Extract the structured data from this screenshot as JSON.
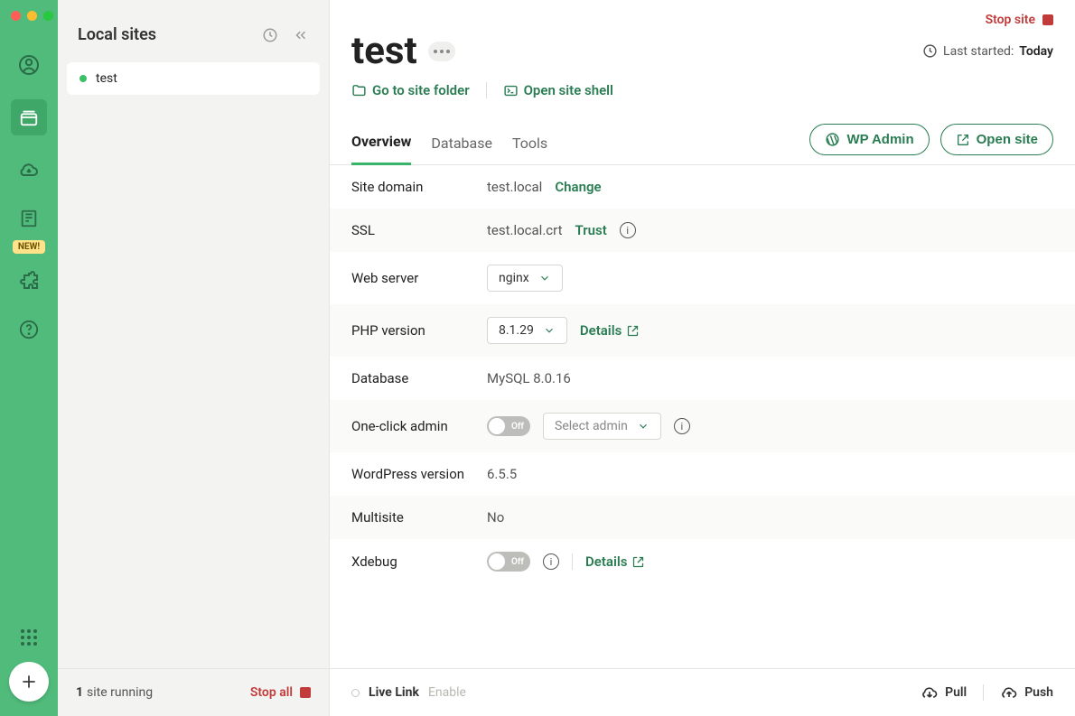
{
  "sidebar": {
    "title": "Local sites",
    "new_badge": "NEW!",
    "sites": [
      {
        "name": "test",
        "running": true
      }
    ],
    "footer": {
      "count": "1",
      "label": "site running",
      "stop_all": "Stop all"
    }
  },
  "topbar": {
    "stop_site": "Stop site"
  },
  "header": {
    "site_name": "test",
    "last_started_label": "Last started:",
    "last_started_value": "Today",
    "go_to_folder": "Go to site folder",
    "open_shell": "Open site shell"
  },
  "tabs": {
    "overview": "Overview",
    "database": "Database",
    "tools": "Tools",
    "wp_admin": "WP Admin",
    "open_site": "Open site"
  },
  "details": {
    "site_domain": {
      "label": "Site domain",
      "value": "test.local",
      "action": "Change"
    },
    "ssl": {
      "label": "SSL",
      "value": "test.local.crt",
      "action": "Trust"
    },
    "web_server": {
      "label": "Web server",
      "value": "nginx"
    },
    "php_version": {
      "label": "PHP version",
      "value": "8.1.29",
      "action": "Details"
    },
    "database": {
      "label": "Database",
      "value": "MySQL 8.0.16"
    },
    "one_click_admin": {
      "label": "One-click admin",
      "toggle": "Off",
      "placeholder": "Select admin"
    },
    "wp_version": {
      "label": "WordPress version",
      "value": "6.5.5"
    },
    "multisite": {
      "label": "Multisite",
      "value": "No"
    },
    "xdebug": {
      "label": "Xdebug",
      "toggle": "Off",
      "action": "Details"
    }
  },
  "footer": {
    "live_link": "Live Link",
    "enable": "Enable",
    "pull": "Pull",
    "push": "Push"
  }
}
